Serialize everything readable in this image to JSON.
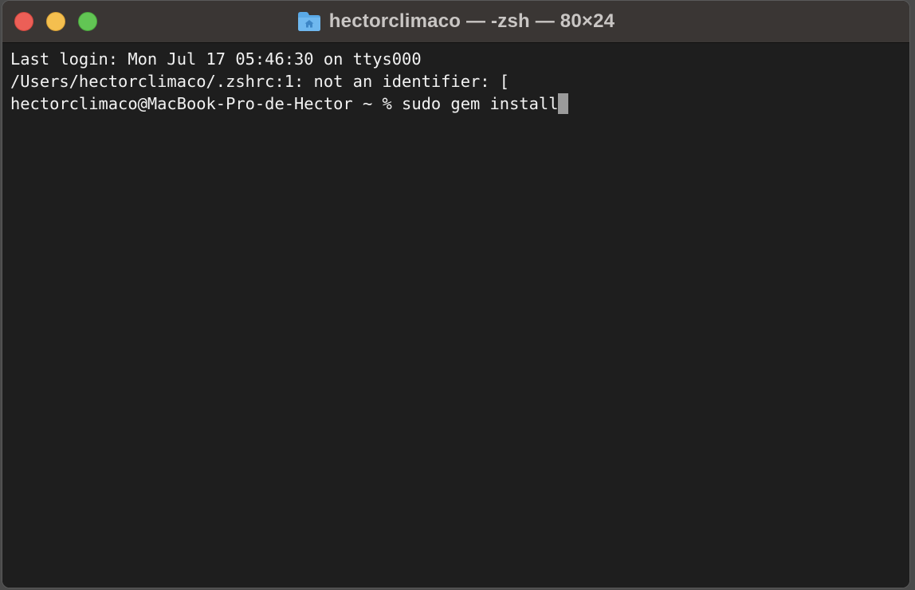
{
  "window": {
    "title": "hectorclimaco — -zsh — 80×24",
    "title_icon": "home-folder-icon",
    "colors": {
      "close": "#ec5f57",
      "minimize": "#f4bf4f",
      "zoom": "#62c554",
      "background": "#1e1e1e",
      "text": "#f2f2f2"
    }
  },
  "terminal": {
    "lines": [
      "Last login: Mon Jul 17 05:46:30 on ttys000",
      "/Users/hectorclimaco/.zshrc:1: not an identifier: [",
      "hectorclimaco@MacBook-Pro-de-Hector ~ % sudo gem install"
    ]
  }
}
